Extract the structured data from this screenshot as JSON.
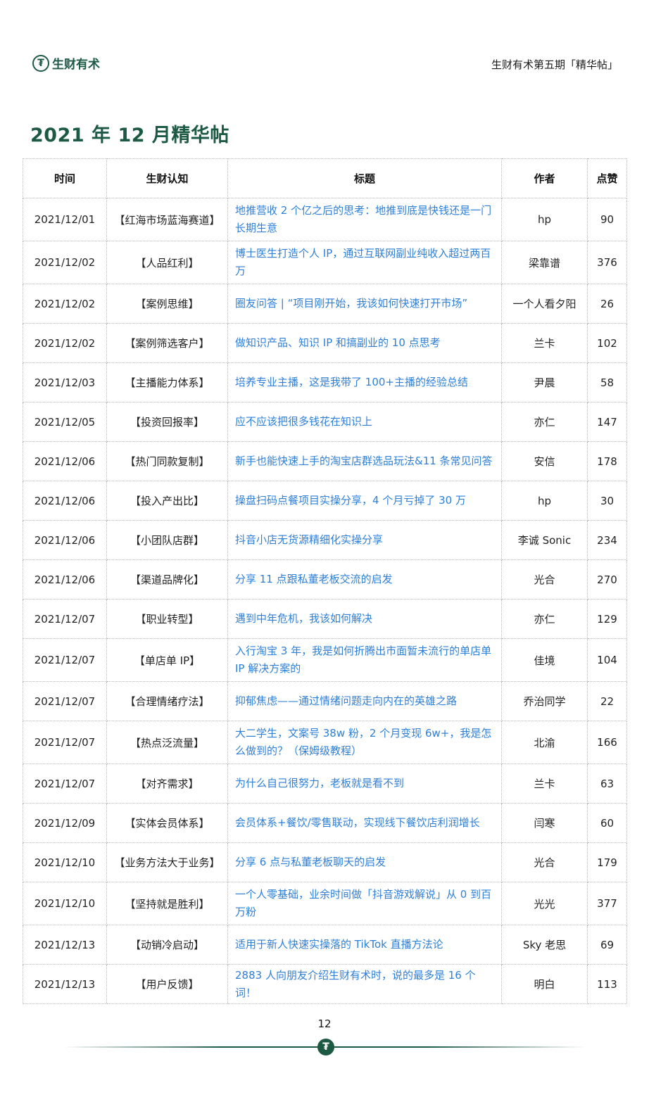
{
  "header": {
    "logo_glyph": "₮",
    "logo_text": "生财有术",
    "right_text": "生财有术第五期「精华帖」"
  },
  "page_title": "2021 年 12 月精华帖",
  "table": {
    "columns": [
      "时间",
      "生财认知",
      "标题",
      "作者",
      "点赞"
    ],
    "rows": [
      {
        "date": "2021/12/01",
        "category": "【红海市场蓝海赛道】",
        "title": "地推营收 2 个亿之后的思考：地推到底是快钱还是一门长期生意",
        "author": "hp",
        "likes": "90"
      },
      {
        "date": "2021/12/02",
        "category": "【人品红利】",
        "title": "博士医生打造个人 IP，通过互联网副业纯收入超过两百万",
        "author": "梁靠谱",
        "likes": "376"
      },
      {
        "date": "2021/12/02",
        "category": "【案例思维】",
        "title": "圈友问答 | “项目刚开始，我该如何快速打开市场”",
        "author": "一个人看夕阳",
        "likes": "26"
      },
      {
        "date": "2021/12/02",
        "category": "【案例筛选客户】",
        "title": "做知识产品、知识 IP 和搞副业的 10 点思考",
        "author": "兰卡",
        "likes": "102"
      },
      {
        "date": "2021/12/03",
        "category": "【主播能力体系】",
        "title": "培养专业主播，这是我带了 100+主播的经验总结",
        "author": "尹晨",
        "likes": "58"
      },
      {
        "date": "2021/12/05",
        "category": "【投资回报率】",
        "title": "应不应该把很多钱花在知识上",
        "author": "亦仁",
        "likes": "147"
      },
      {
        "date": "2021/12/06",
        "category": "【热门同款复制】",
        "title": "新手也能快速上手的淘宝店群选品玩法&11 条常见问答",
        "author": "安信",
        "likes": "178"
      },
      {
        "date": "2021/12/06",
        "category": "【投入产出比】",
        "title": "操盘扫码点餐项目实操分享，4 个月亏掉了 30 万",
        "author": "hp",
        "likes": "30"
      },
      {
        "date": "2021/12/06",
        "category": "【小团队店群】",
        "title": "抖音小店无货源精细化实操分享",
        "author": "李诚 Sonic",
        "likes": "234"
      },
      {
        "date": "2021/12/06",
        "category": "【渠道品牌化】",
        "title": "分享 11 点跟私董老板交流的启发",
        "author": "光合",
        "likes": "270"
      },
      {
        "date": "2021/12/07",
        "category": "【职业转型】",
        "title": "遇到中年危机，我该如何解决",
        "author": "亦仁",
        "likes": "129"
      },
      {
        "date": "2021/12/07",
        "category": "【单店单 IP】",
        "title": "入行淘宝 3 年，我是如何折腾出市面暂未流行的单店单 IP 解决方案的",
        "author": "佳境",
        "likes": "104"
      },
      {
        "date": "2021/12/07",
        "category": "【合理情绪疗法】",
        "title": "抑郁焦虑——通过情绪问题走向内在的英雄之路",
        "author": "乔治同学",
        "likes": "22"
      },
      {
        "date": "2021/12/07",
        "category": "【热点泛流量】",
        "title": "大二学生，文案号 38w 粉，2 个月变现 6w+，我是怎么做到的？（保姆级教程）",
        "author": "北渝",
        "likes": "166"
      },
      {
        "date": "2021/12/07",
        "category": "【对齐需求】",
        "title": "为什么自己很努力，老板就是看不到",
        "author": "兰卡",
        "likes": "63"
      },
      {
        "date": "2021/12/09",
        "category": "【实体会员体系】",
        "title": "会员体系+餐饮/零售联动，实现线下餐饮店利润增长",
        "author": "闫寒",
        "likes": "60"
      },
      {
        "date": "2021/12/10",
        "category": "【业务方法大于业务】",
        "title": "分享 6 点与私董老板聊天的启发",
        "author": "光合",
        "likes": "179"
      },
      {
        "date": "2021/12/10",
        "category": "【坚持就是胜利】",
        "title": "一个人零基础，业余时间做「抖音游戏解说」从 0 到百万粉",
        "author": "光光",
        "likes": "377"
      },
      {
        "date": "2021/12/13",
        "category": "【动销冷启动】",
        "title": "适用于新人快速实操落的 TikTok 直播方法论",
        "author": "Sky 老思",
        "likes": "69"
      },
      {
        "date": "2021/12/13",
        "category": "【用户反馈】",
        "title": "2883 人向朋友介绍生财有术时，说的最多是 16 个词！",
        "author": "明白",
        "likes": "113"
      }
    ]
  },
  "footer": {
    "page_number": "12",
    "badge_glyph": "₮"
  },
  "colors": {
    "brand_green": "#1d5a44",
    "link_blue": "#2f7fd7"
  }
}
